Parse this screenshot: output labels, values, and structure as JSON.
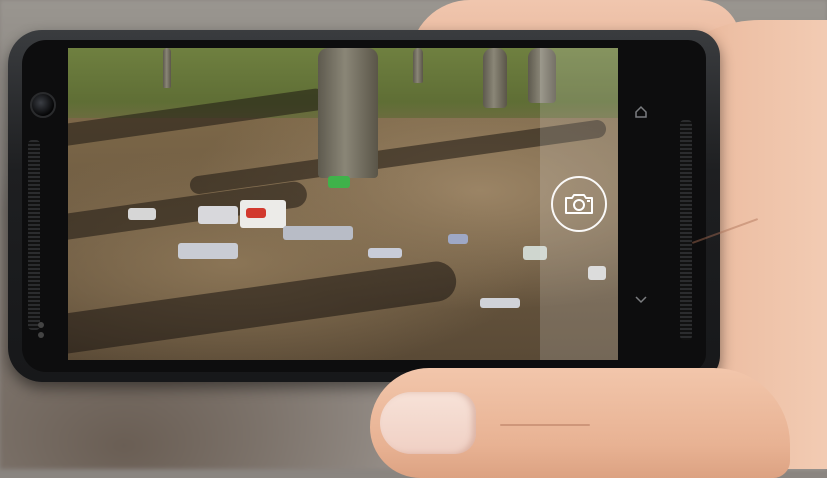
{
  "scene": {
    "description_tags": [
      "hand-holding-phone",
      "camera-viewfinder",
      "litter-in-park"
    ]
  },
  "camera_app": {
    "shutter_icon": "camera-icon",
    "home_key_icon": "home-icon",
    "back_key_icon": "chevron-down-icon"
  },
  "colors": {
    "phone_body": "#1e1f21",
    "skin": "#edbfa4",
    "shutter_ring": "#ffffff"
  }
}
